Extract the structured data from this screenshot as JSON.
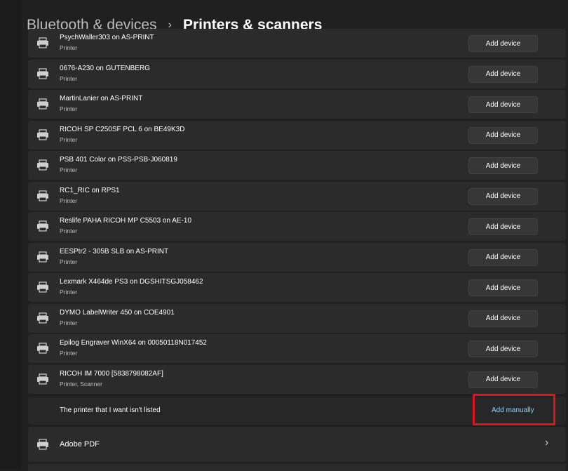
{
  "breadcrumb": {
    "parent": "Bluetooth & devices",
    "separator": "›",
    "current": "Printers & scanners"
  },
  "icons": {
    "printer": "printer-icon",
    "chevron": "chevron-right-icon"
  },
  "devices": [
    {
      "name": "PsychWaller303 on AS-PRINT",
      "type": "Printer",
      "action": "Add device"
    },
    {
      "name": "0676-A230 on GUTENBERG",
      "type": "Printer",
      "action": "Add device"
    },
    {
      "name": "MartinLanier on AS-PRINT",
      "type": "Printer",
      "action": "Add device"
    },
    {
      "name": "RICOH SP C250SF PCL 6 on BE49K3D",
      "type": "Printer",
      "action": "Add device"
    },
    {
      "name": "PSB 401 Color on PSS-PSB-J060819",
      "type": "Printer",
      "action": "Add device"
    },
    {
      "name": "RC1_RIC on RPS1",
      "type": "Printer",
      "action": "Add device"
    },
    {
      "name": "Reslife PAHA RICOH MP C5503 on AE-10",
      "type": "Printer",
      "action": "Add device"
    },
    {
      "name": "EESPtr2 - 305B SLB on AS-PRINT",
      "type": "Printer",
      "action": "Add device"
    },
    {
      "name": "Lexmark X464de PS3 on DGSHITSGJ058462",
      "type": "Printer",
      "action": "Add device"
    },
    {
      "name": "DYMO LabelWriter 450 on COE4901",
      "type": "Printer",
      "action": "Add device"
    },
    {
      "name": "Epilog Engraver WinX64 on 00050118N017452",
      "type": "Printer",
      "action": "Add device"
    },
    {
      "name": "RICOH IM 7000 [5838798082AF]",
      "type": "Printer, Scanner",
      "action": "Add device"
    }
  ],
  "not_listed": {
    "text": "The printer that I want isn't listed",
    "action": "Add manually"
  },
  "installed": [
    {
      "name": "Adobe PDF"
    }
  ],
  "colors": {
    "background": "#202020",
    "card": "#2b2b2b",
    "button": "#373737",
    "link": "#8fd2ff",
    "highlight": "#e0141c"
  }
}
